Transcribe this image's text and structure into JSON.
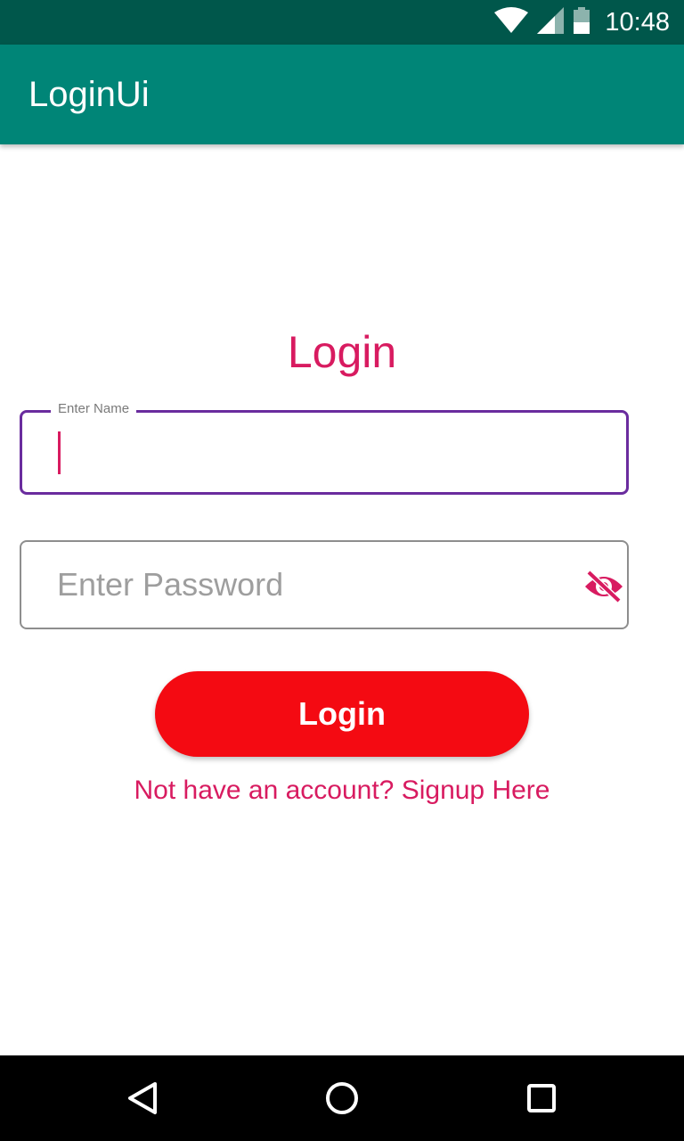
{
  "status_bar": {
    "time": "10:48",
    "icons": [
      "wifi-icon",
      "signal-icon",
      "battery-icon"
    ]
  },
  "app_bar": {
    "title": "LoginUi"
  },
  "form": {
    "heading": "Login",
    "name_field": {
      "label": "Enter Name",
      "value": ""
    },
    "password_field": {
      "placeholder": "Enter Password",
      "value": "",
      "toggle_icon": "eye-off-icon"
    },
    "login_button_label": "Login",
    "signup_link": "Not have an account? Signup Here"
  },
  "nav_bar": {
    "buttons": [
      "back-icon",
      "home-icon",
      "recents-icon"
    ]
  },
  "colors": {
    "status_bar": "#00574b",
    "app_bar": "#008577",
    "accent": "#d81b60",
    "focus_border": "#6a2c9e",
    "button": "#f40a12"
  }
}
